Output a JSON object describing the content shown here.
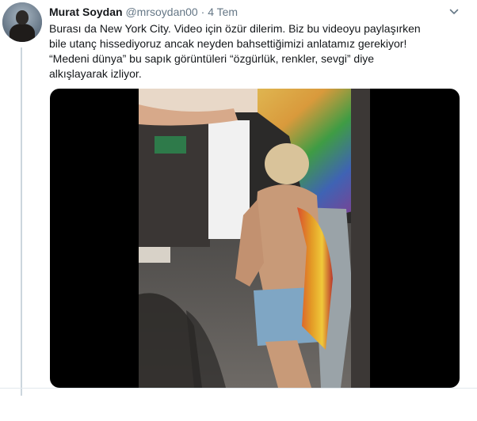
{
  "tweet": {
    "author_name": "Murat Soydan",
    "handle": "@mrsoydan00",
    "separator": "·",
    "time": "4 Tem",
    "text_line1": "Burası da New York City. Video için özür dilerim. Biz bu videoyu paylaşırken",
    "text_line2": "bile utanç hissediyoruz ancak neyden bahsettiğimizi anlatamız gerekiyor!",
    "text_line3": "“Medeni dünya” bu sapık görüntüleri “özgürlük, renkler, sevgi” diye",
    "text_line4": "alkışlayarak izliyor."
  },
  "icons": {
    "menu": "chevron-down-icon"
  },
  "colors": {
    "name": "#14171a",
    "secondary": "#657786",
    "thread_line": "#ccd6dd",
    "media_background": "#000000"
  }
}
